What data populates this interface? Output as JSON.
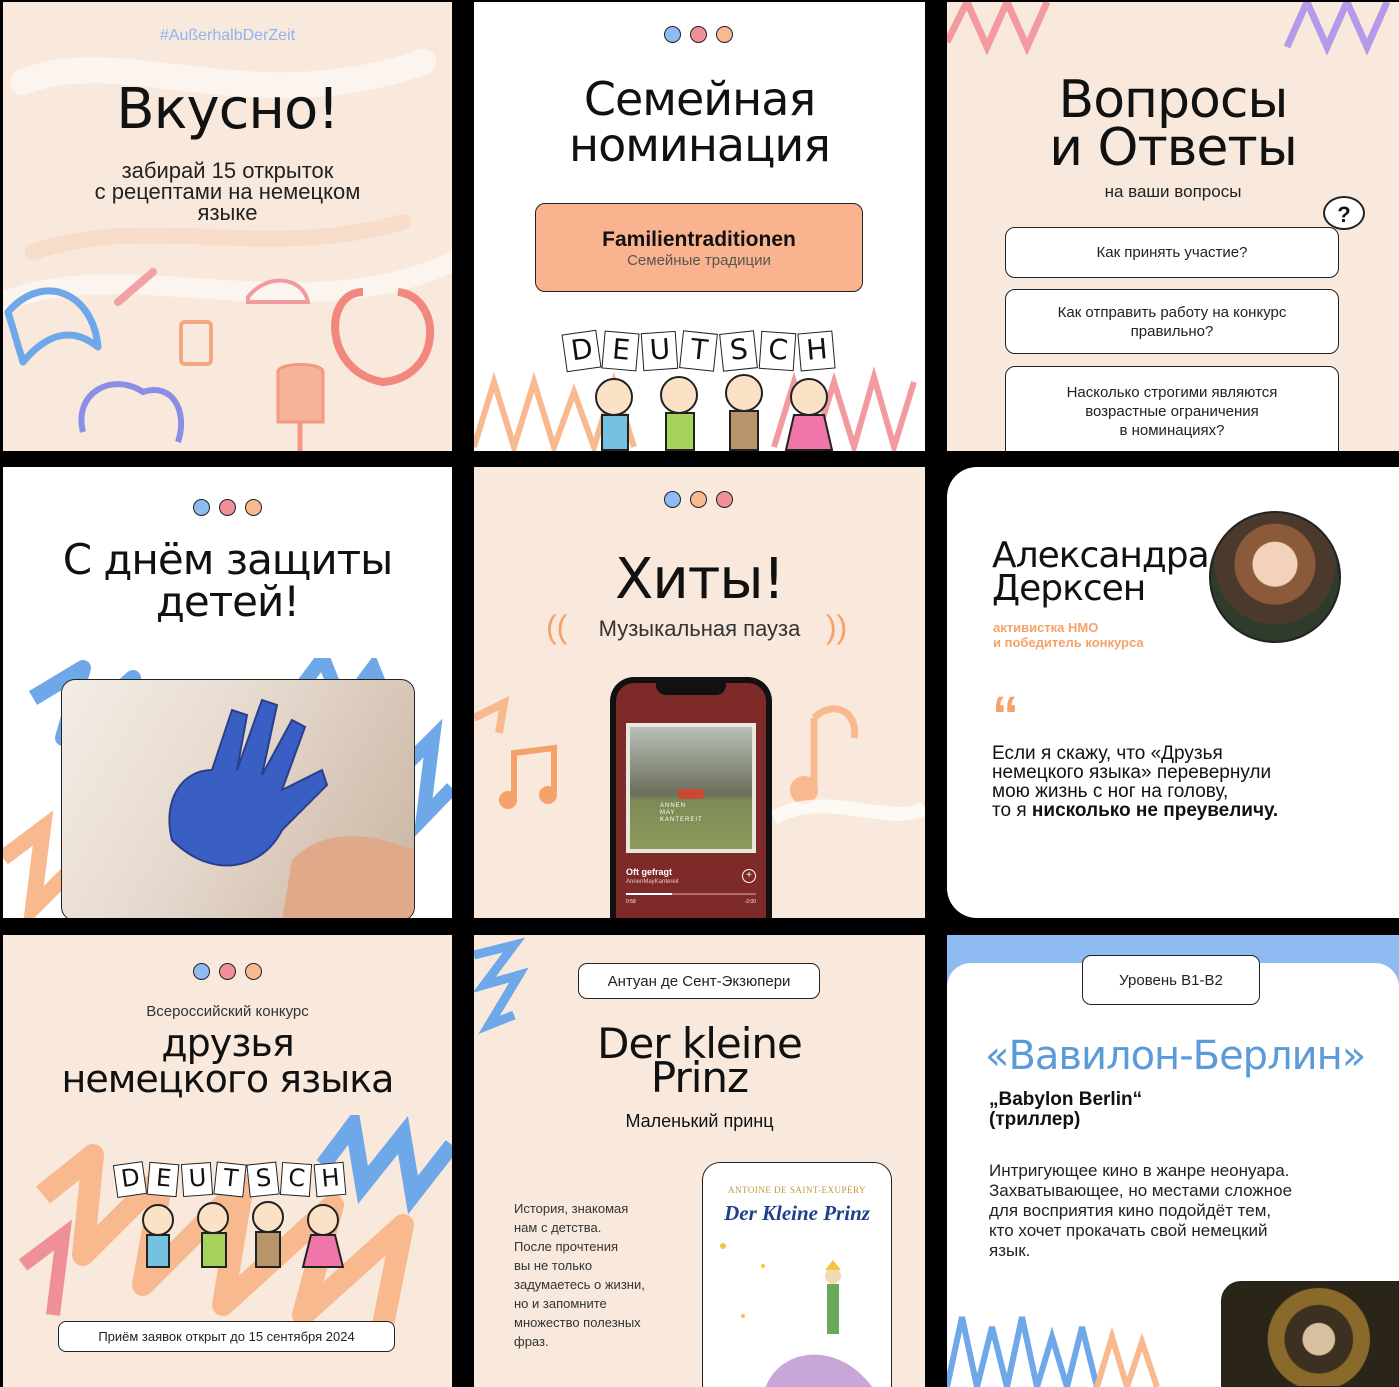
{
  "cards": {
    "c1": {
      "hashtag": "#AußerhalbDerZeit",
      "title": "Вкусно!",
      "subtitle": "забирай 15 открыток\nс рецептами на немецком\nязыке"
    },
    "c2": {
      "title": "Семейная\nноминация",
      "box_title": "Familientraditionen",
      "box_subtitle": "Семейные традиции",
      "sign_letters": [
        "D",
        "E",
        "U",
        "T",
        "S",
        "C",
        "H"
      ]
    },
    "c3": {
      "title": "Вопросы\nи Ответы",
      "subtitle": "на ваши вопросы",
      "questions": [
        "Как принять участие?",
        "Как отправить работу на конкурс\nправильно?",
        "Насколько строгими являются\nвозрастные ограничения\nв номинациях?"
      ]
    },
    "c4": {
      "title": "С днём защиты\nдетей!"
    },
    "c5": {
      "title": "Хиты!",
      "subtitle": "Музыкальная пауза",
      "song_title": "Oft gefragt",
      "song_artist": "AnnenMayKantereit",
      "time_elapsed": "0:58",
      "time_remaining": "-2:00",
      "album_text": "ANNEN\nMAY\nKANTEREIT"
    },
    "c6": {
      "name": "Александра\nДерксен",
      "role": "активистка НМО\nи победитель конкурса",
      "quote_plain": "Если я скажу, что «Друзья\nнемецкого языка» перевернули\nмою жизнь с ног на голову,\nто я ",
      "quote_bold": "нисколько не преувеличу."
    },
    "c7": {
      "kicker": "Всероссийский конкурс",
      "title": "друзья\nнемецкого языка",
      "footer": "Приём заявок открыт до 15 сентября 2024",
      "sign_letters": [
        "D",
        "E",
        "U",
        "T",
        "S",
        "C",
        "H"
      ]
    },
    "c8": {
      "author": "Антуан де Сент-Экзюпери",
      "title": "Der kleine\nPrinz",
      "subtitle": "Маленький принц",
      "body": "История, знакомая\nнам с детства.\nПосле прочтения\nвы не только\nзадумаетесь о жизни,\nно и запомните\nмножество полезных\nфраз.",
      "book_author": "ANTOINE DE SAINT-EXUPÉRY",
      "book_title": "Der Kleine Prinz"
    },
    "c9": {
      "level": "Уровень B1-B2",
      "title": "«Вавилон-Берлин»",
      "original": "„Babylon Berlin“\n(триллер)",
      "body": "Интригующее кино в жанре неонуара.\nЗахватывающее, но местами сложное\nдля восприятия кино подойдёт тем,\nкто хочет прокачать свой немецкий\nязык."
    }
  },
  "colors": {
    "beige": "#f8e9dc",
    "blue": "#6fa8e8",
    "pink": "#ef8f96",
    "peach": "#f8b98f",
    "orange": "#f5a26a",
    "title_blue": "#5b9bd8"
  }
}
